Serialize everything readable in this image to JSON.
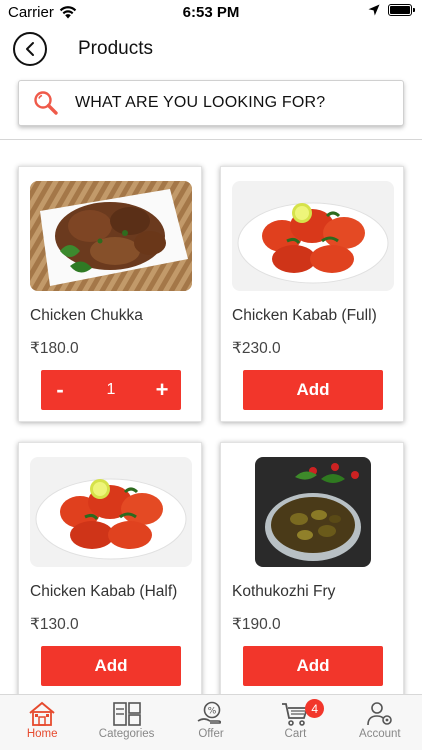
{
  "status_bar": {
    "carrier": "Carrier",
    "time": "6:53 PM"
  },
  "header": {
    "title": "Products"
  },
  "search": {
    "placeholder": "WHAT ARE YOU LOOKING FOR?"
  },
  "products": [
    {
      "name": "Chicken Chukka",
      "price": "₹180.0",
      "quantity": "1",
      "minus": "-",
      "plus": "+"
    },
    {
      "name": "Chicken Kabab (Full)",
      "price": "₹230.0",
      "action": "Add"
    },
    {
      "name": "Chicken Kabab (Half)",
      "price": "₹130.0",
      "action": "Add"
    },
    {
      "name": "Kothukozhi Fry",
      "price": "₹190.0",
      "action": "Add"
    }
  ],
  "tabs": [
    {
      "label": "Home",
      "icon": "home-icon",
      "active": true
    },
    {
      "label": "Categories",
      "icon": "categories-icon"
    },
    {
      "label": "Offer",
      "icon": "offer-icon"
    },
    {
      "label": "Cart",
      "icon": "cart-icon",
      "badge": "4"
    },
    {
      "label": "Account",
      "icon": "account-icon"
    }
  ],
  "colors": {
    "accent": "#f2362b",
    "active_tab": "#e64a2e"
  }
}
